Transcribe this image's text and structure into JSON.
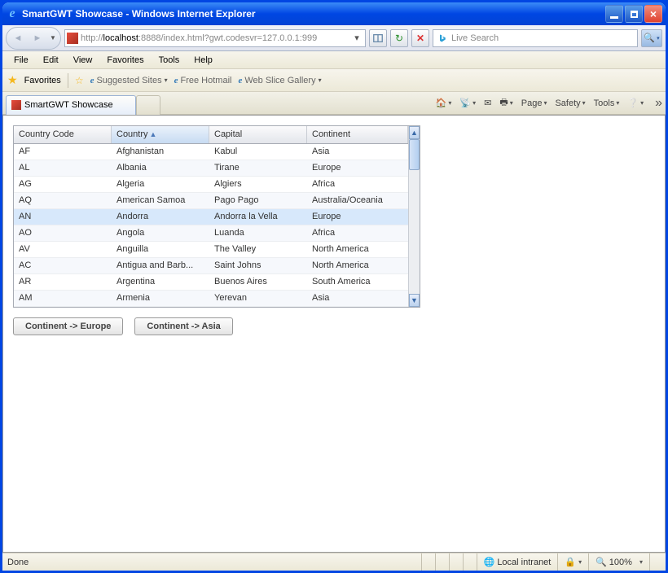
{
  "window": {
    "title": "SmartGWT Showcase - Windows Internet Explorer"
  },
  "address": {
    "prefix": "http://",
    "host": "localhost",
    "path": ":8888/index.html?gwt.codesvr=127.0.0.1:999"
  },
  "search": {
    "placeholder": "Live Search"
  },
  "menu": {
    "file": "File",
    "edit": "Edit",
    "view": "View",
    "favorites": "Favorites",
    "tools": "Tools",
    "help": "Help"
  },
  "favbar": {
    "favorites": "Favorites",
    "suggested": "Suggested Sites",
    "hotmail": "Free Hotmail",
    "webslice": "Web Slice Gallery"
  },
  "tab": {
    "title": "SmartGWT Showcase"
  },
  "cmdbar": {
    "page": "Page",
    "safety": "Safety",
    "tools": "Tools"
  },
  "grid": {
    "headers": {
      "countryCode": "Country Code",
      "country": "Country",
      "capital": "Capital",
      "continent": "Continent"
    },
    "rows": [
      {
        "code": "AF",
        "country": "Afghanistan",
        "capital": "Kabul",
        "continent": "Asia"
      },
      {
        "code": "AL",
        "country": "Albania",
        "capital": "Tirane",
        "continent": "Europe"
      },
      {
        "code": "AG",
        "country": "Algeria",
        "capital": "Algiers",
        "continent": "Africa"
      },
      {
        "code": "AQ",
        "country": "American Samoa",
        "capital": "Pago Pago",
        "continent": "Australia/Oceania"
      },
      {
        "code": "AN",
        "country": "Andorra",
        "capital": "Andorra la Vella",
        "continent": "Europe"
      },
      {
        "code": "AO",
        "country": "Angola",
        "capital": "Luanda",
        "continent": "Africa"
      },
      {
        "code": "AV",
        "country": "Anguilla",
        "capital": "The Valley",
        "continent": "North America"
      },
      {
        "code": "AC",
        "country": "Antigua and Barb...",
        "capital": "Saint Johns",
        "continent": "North America"
      },
      {
        "code": "AR",
        "country": "Argentina",
        "capital": "Buenos Aires",
        "continent": "South America"
      },
      {
        "code": "AM",
        "country": "Armenia",
        "capital": "Yerevan",
        "continent": "Asia"
      }
    ],
    "selectedIndex": 4
  },
  "buttons": {
    "europe": "Continent -> Europe",
    "asia": "Continent -> Asia"
  },
  "status": {
    "done": "Done",
    "zone": "Local intranet",
    "zoom": "100%"
  }
}
